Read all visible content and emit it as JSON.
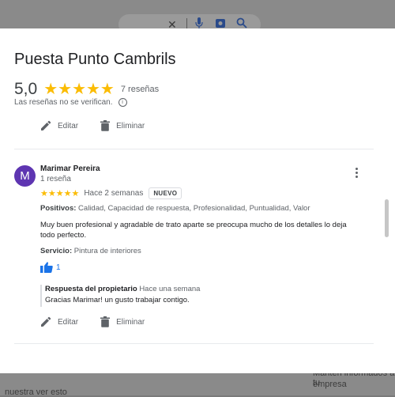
{
  "colors": {
    "star": "#fbbc04",
    "avatar_bg": "#5e35b1",
    "link_blue": "#1a73e8",
    "overlay": "#7a7a7a"
  },
  "background": {
    "icons": [
      "close-icon",
      "microphone-icon",
      "lens-icon",
      "search-icon"
    ],
    "bottom_right_1": "Mantén informados a tu",
    "bottom_right_2": "empresa",
    "bottom_left": "nuestra ver esto"
  },
  "dialog": {
    "title": "Puesta Punto Cambrils",
    "rating_value": "5,0",
    "rating_stars": 5,
    "stars_text": "★★★★★",
    "review_count": "7 reseñas",
    "note": "Las reseñas no se verifican.",
    "edit_label": "Editar",
    "delete_label": "Eliminar"
  },
  "review": {
    "avatar_letter": "M",
    "author": "Marimar Pereira",
    "author_reviews": "1 reseña",
    "stars": 5,
    "stars_text": "★★★★★",
    "time": "Hace 2 semanas",
    "badge": "NUEVO",
    "positives_label": "Positivos:",
    "positives": "Calidad, Capacidad de respuesta, Profesionalidad, Puntualidad, Valor",
    "text": "Muy buen profesional y agradable de trato aparte se preocupa mucho de los detalles lo deja todo perfecto.",
    "service_label": "Servicio:",
    "service": "Pintura de interiores",
    "likes": "1",
    "owner_label": "Respuesta del propietario",
    "owner_time": "Hace una semana",
    "owner_text": "Gracias Marimar! un gusto trabajar contigo.",
    "edit_label": "Editar",
    "delete_label": "Eliminar"
  }
}
